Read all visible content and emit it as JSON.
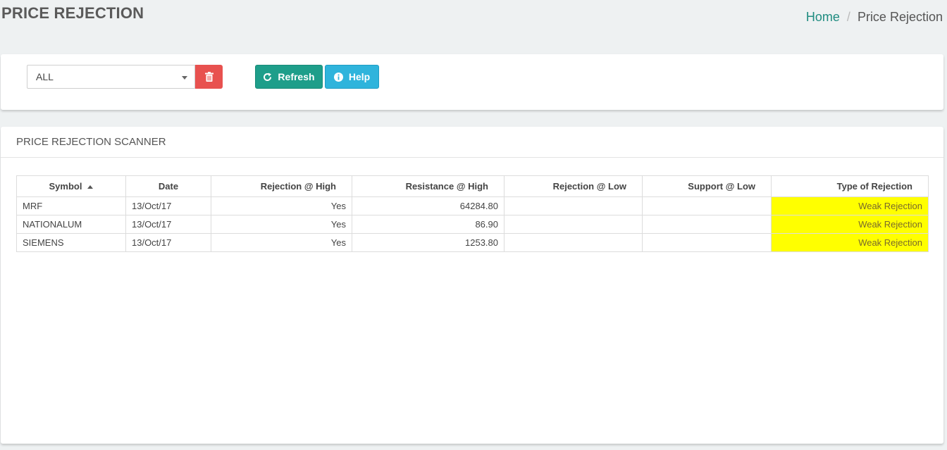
{
  "header": {
    "title": "PRICE REJECTION",
    "breadcrumb_home": "Home",
    "breadcrumb_separator": "/",
    "breadcrumb_current": "Price Rejection"
  },
  "toolbar": {
    "select_value": "ALL",
    "refresh_label": "Refresh",
    "help_label": "Help",
    "icons": [
      "trash-icon",
      "refresh-icon",
      "info-icon",
      "chevron-down-icon"
    ]
  },
  "scanner": {
    "title": "PRICE REJECTION SCANNER",
    "columns": [
      "Symbol",
      "Date",
      "Rejection @ High",
      "Resistance @ High",
      "Rejection @ Low",
      "Support @ Low",
      "Type of Rejection"
    ],
    "sort": {
      "column": "Symbol",
      "direction": "ascending"
    },
    "rows": [
      {
        "symbol": "MRF",
        "date": "13/Oct/17",
        "rejection_high": "Yes",
        "resistance_high": "64284.80",
        "rejection_low": "",
        "support_low": "",
        "type": "Weak Rejection"
      },
      {
        "symbol": "NATIONALUM",
        "date": "13/Oct/17",
        "rejection_high": "Yes",
        "resistance_high": "86.90",
        "rejection_low": "",
        "support_low": "",
        "type": "Weak Rejection"
      },
      {
        "symbol": "SIEMENS",
        "date": "13/Oct/17",
        "rejection_high": "Yes",
        "resistance_high": "1253.80",
        "rejection_low": "",
        "support_low": "",
        "type": "Weak Rejection"
      }
    ]
  },
  "colors": {
    "accent": "#1e9e8a",
    "danger": "#e8514f",
    "info": "#2fb4dc",
    "weak_highlight": "#ffff00"
  }
}
